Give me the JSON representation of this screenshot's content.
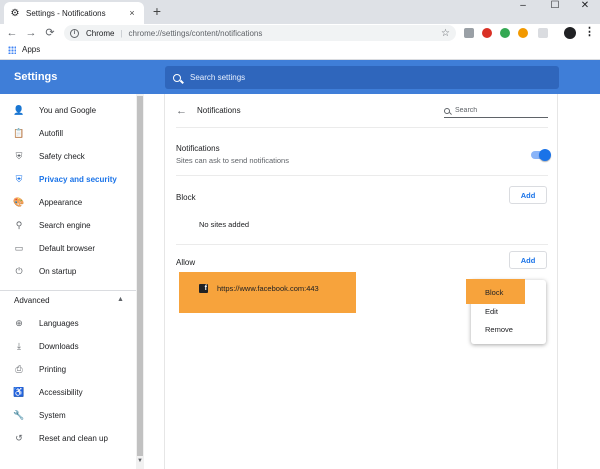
{
  "window": {
    "tab_title": "Settings - Notifications",
    "tab_close": "×",
    "new_tab": "+",
    "minimize": "–",
    "maximize": "☐",
    "close": "✕"
  },
  "toolbar": {
    "scheme": "Chrome",
    "separator": "|",
    "url": "chrome://settings/content/notifications",
    "back": "←",
    "forward": "→",
    "reload": "⟳",
    "star": "☆",
    "menu": "⋮"
  },
  "bookmarks": {
    "apps_label": "Apps"
  },
  "header": {
    "title": "Settings",
    "search_placeholder": "Search settings"
  },
  "sidebar": {
    "items": [
      {
        "label": "You and Google",
        "icon": "person-icon",
        "glyph": "👤"
      },
      {
        "label": "Autofill",
        "icon": "clipboard-icon",
        "glyph": "📋"
      },
      {
        "label": "Safety check",
        "icon": "shield-icon",
        "glyph": "⛨"
      },
      {
        "label": "Privacy and security",
        "icon": "shield-icon",
        "glyph": "⛨",
        "active": true
      },
      {
        "label": "Appearance",
        "icon": "palette-icon",
        "glyph": "🎨"
      },
      {
        "label": "Search engine",
        "icon": "search-icon",
        "glyph": "⚲"
      },
      {
        "label": "Default browser",
        "icon": "browser-icon",
        "glyph": "▭"
      },
      {
        "label": "On startup",
        "icon": "power-icon",
        "glyph": "⏻"
      }
    ],
    "advanced_label": "Advanced",
    "advanced_caret": "▲",
    "advanced_items": [
      {
        "label": "Languages",
        "icon": "globe-icon",
        "glyph": "⊕"
      },
      {
        "label": "Downloads",
        "icon": "download-icon",
        "glyph": "⤓"
      },
      {
        "label": "Printing",
        "icon": "printer-icon",
        "glyph": "⎙"
      },
      {
        "label": "Accessibility",
        "icon": "accessibility-icon",
        "glyph": "♿"
      },
      {
        "label": "System",
        "icon": "wrench-icon",
        "glyph": "🔧"
      },
      {
        "label": "Reset and clean up",
        "icon": "history-icon",
        "glyph": "↺"
      }
    ]
  },
  "main": {
    "back_arrow": "←",
    "title": "Notifications",
    "search_placeholder": "Search",
    "toggle": {
      "title": "Notifications",
      "subtitle": "Sites can ask to send notifications",
      "checked": true
    },
    "block": {
      "label": "Block",
      "add_label": "Add",
      "empty_text": "No sites added"
    },
    "allow": {
      "label": "Allow",
      "add_label": "Add",
      "sites": [
        {
          "url": "https://www.facebook.com:443",
          "icon": "facebook-icon",
          "glyph": "f"
        }
      ]
    },
    "context_menu": {
      "items": [
        "Block",
        "Edit",
        "Remove"
      ]
    }
  },
  "colors": {
    "header": "#3f7ed8",
    "accent": "#1a73e8",
    "highlight": "#f7a33c"
  }
}
